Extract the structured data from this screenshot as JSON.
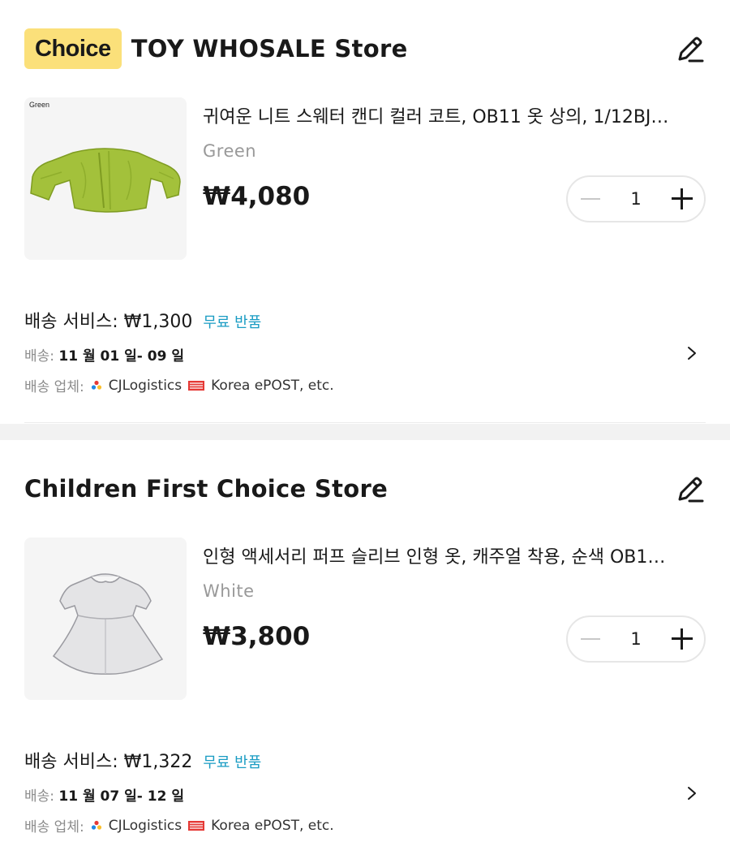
{
  "stores": [
    {
      "badge": "Choice",
      "name": "TOY WHOSALE Store",
      "product": {
        "thumb_caption": "Green",
        "title": "귀여운 니트 스웨터 캔디 컬러 코트, OB11 옷 상의, 1/12BJ…",
        "variant": "Green",
        "price": "₩4,080",
        "quantity": "1"
      },
      "shipping": {
        "service_label": "배송 서비스:",
        "service_price": "₩1,300",
        "free_return": "무료 반품",
        "delivery_label": "배송:",
        "delivery_dates": "11 월 01 일- 09 일",
        "carriers_label": "배송 업체:",
        "carrier1": "CJLogistics",
        "carrier2": "Korea ePOST, etc."
      }
    },
    {
      "name": "Children First Choice Store",
      "product": {
        "title": "인형 액세서리 퍼프 슬리브 인형 옷, 캐주얼 착용, 순색 OB1…",
        "variant": "White",
        "price": "₩3,800",
        "quantity": "1"
      },
      "shipping": {
        "service_label": "배송 서비스:",
        "service_price": "₩1,322",
        "free_return": "무료 반품",
        "delivery_label": "배송:",
        "delivery_dates": "11 월 07 일- 12 일",
        "carriers_label": "배송 업체:",
        "carrier1": "CJLogistics",
        "carrier2": "Korea ePOST, etc."
      }
    }
  ],
  "icons": {
    "edit": "pencil-icon",
    "chevron": "chevron-right-icon",
    "minus": "minus-icon",
    "plus": "plus-icon"
  },
  "colors": {
    "choice_badge": "#fbe07a",
    "free_return": "#1a9cc3",
    "section_band": "#f2f2f2"
  }
}
